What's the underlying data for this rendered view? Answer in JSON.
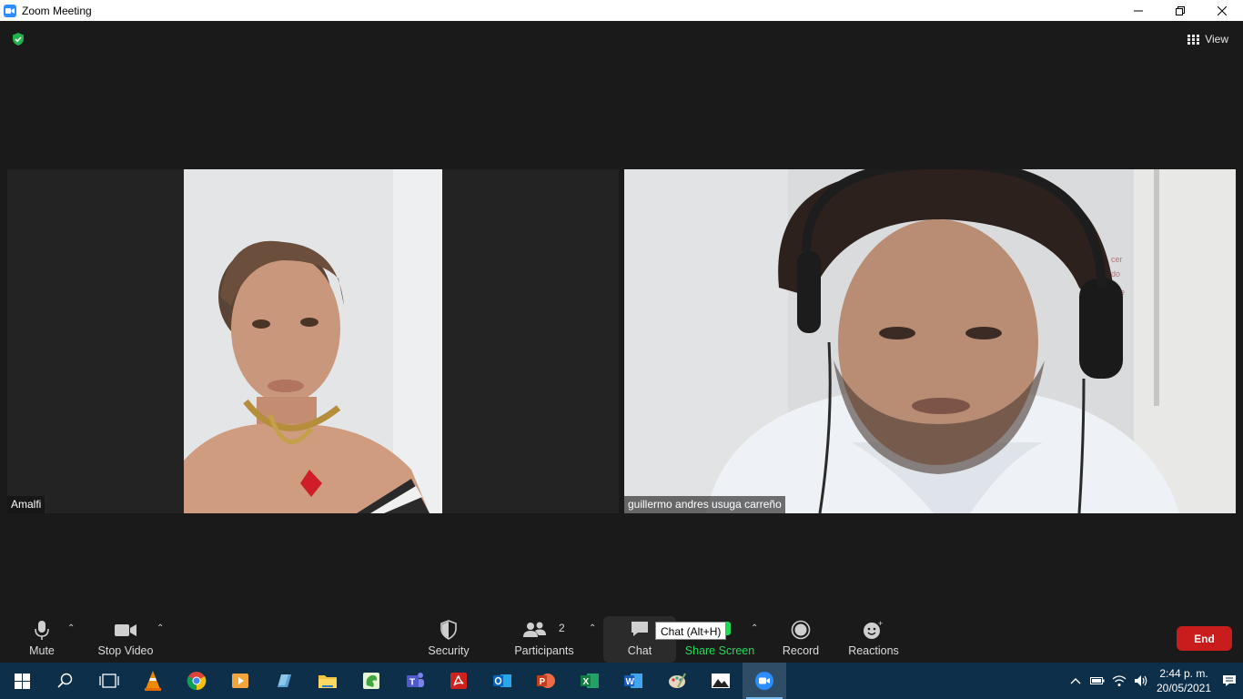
{
  "window": {
    "title": "Zoom Meeting",
    "minimize": "—",
    "restore": "❐",
    "close": "✕"
  },
  "meeting": {
    "view_label": "View",
    "participants": [
      {
        "name": "Amalfi"
      },
      {
        "name": "guillermo andres usuga carreño"
      }
    ]
  },
  "toolbar": {
    "mute": "Mute",
    "stop_video": "Stop Video",
    "security": "Security",
    "participants": "Participants",
    "participants_count": "2",
    "chat": "Chat",
    "chat_tooltip": "Chat (Alt+H)",
    "share_screen": "Share Screen",
    "record": "Record",
    "reactions": "Reactions",
    "end": "End"
  },
  "taskbar": {
    "apps": [
      "start",
      "search",
      "task-view",
      "vlc",
      "chrome",
      "media-player",
      "notes",
      "file-explorer",
      "app-green",
      "teams",
      "acrobat",
      "outlook",
      "powerpoint",
      "excel",
      "word",
      "paint",
      "photos",
      "zoom"
    ],
    "clock_time": "2:44 p. m.",
    "clock_date": "20/05/2021"
  },
  "colors": {
    "accent": "#2d8cff",
    "share_green": "#23d959",
    "end_red": "#c91d1d",
    "taskbar": "#0e2f4a"
  }
}
